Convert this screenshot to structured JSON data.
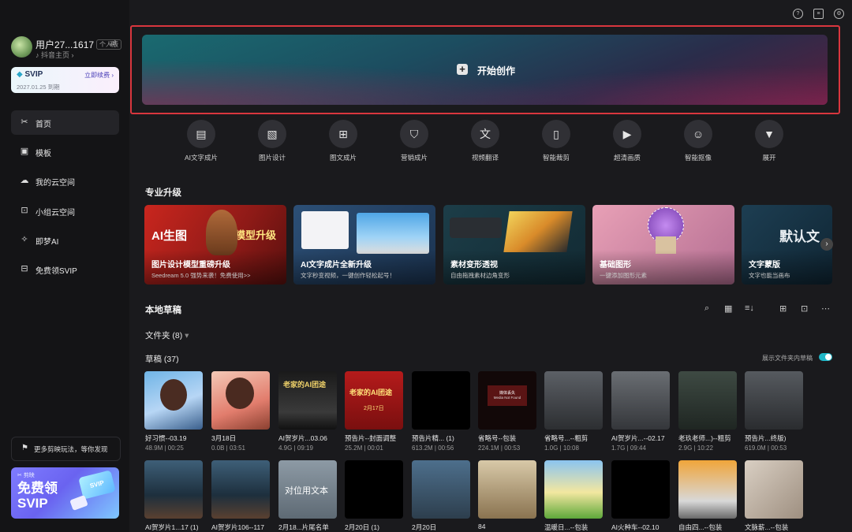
{
  "user": {
    "name": "用户27...1617",
    "badge": "个人版",
    "sub": "抖音主页"
  },
  "svip": {
    "title": "SVIP",
    "expiry": "2027.01.25 到期",
    "renew": "立即续费"
  },
  "nav": [
    {
      "label": "首页",
      "icon": "scissors-icon",
      "active": true
    },
    {
      "label": "模板",
      "icon": "template-icon"
    },
    {
      "label": "我的云空间",
      "icon": "cloud-icon"
    },
    {
      "label": "小组云空间",
      "icon": "group-cloud-icon"
    },
    {
      "label": "即梦AI",
      "icon": "jimeng-icon"
    },
    {
      "label": "免费领SVIP",
      "icon": "gift-icon"
    }
  ],
  "promo": {
    "label": "更多剪映玩法，等你发现"
  },
  "svip_banner": {
    "brand": "剪映",
    "line1": "免费领",
    "line2": "SVIP",
    "card": "SVIP"
  },
  "create": {
    "label": "开始创作"
  },
  "tools": [
    {
      "label": "AI文字成片",
      "icon": "ai-text-video-icon"
    },
    {
      "label": "图片设计",
      "icon": "image-design-icon"
    },
    {
      "label": "图文成片",
      "icon": "text-image-video-icon"
    },
    {
      "label": "营销成片",
      "icon": "marketing-video-icon"
    },
    {
      "label": "视频翻译",
      "icon": "translate-icon"
    },
    {
      "label": "智能裁剪",
      "icon": "smart-crop-icon"
    },
    {
      "label": "超清画质",
      "icon": "hd-quality-icon"
    },
    {
      "label": "智能抠像",
      "icon": "smart-cutout-icon"
    },
    {
      "label": "展开",
      "icon": "expand-icon"
    }
  ],
  "pro_title": "专业升级",
  "pro_cards": [
    {
      "title": "图片设计模型重磅升级",
      "sub": "Seedream 5.0 强势来袭！免费使用>>",
      "art_left": "AI生图",
      "art_right": "模型升级"
    },
    {
      "title": "AI文字成片全新升级",
      "sub": "文字秒变视频，一键创作轻松起号！"
    },
    {
      "title": "素材变形透视",
      "sub": "自由拖拽素材边角变形"
    },
    {
      "title": "基础图形",
      "sub": "一键添加图形元素"
    },
    {
      "title": "文字蒙版",
      "sub": "文字也能当画布",
      "art": "默认文"
    }
  ],
  "local_title": "本地草稿",
  "folders": "文件夹 (8)",
  "drafts_title": "草稿 (37)",
  "toggle_label": "展示文件夹内草稿",
  "drafts_row1": [
    {
      "name": "好习惯--03.19",
      "meta": "48.9M | 00:25"
    },
    {
      "name": "3月18日",
      "meta": "0.0B | 03:51"
    },
    {
      "name": "AI贺岁片...03.06",
      "meta": "4.9G | 09:19"
    },
    {
      "name": "预告片--封面调整",
      "meta": "25.2M | 00:01"
    },
    {
      "name": "预告片精... (1)",
      "meta": "613.2M | 00:56"
    },
    {
      "name": "省略号--包装",
      "meta": "224.1M | 00:53"
    },
    {
      "name": "省略号...--粗剪",
      "meta": "1.0G | 10:08"
    },
    {
      "name": "AI贺岁片...--02.17",
      "meta": "1.7G | 09:44"
    },
    {
      "name": "老玖老师...)--粗剪",
      "meta": "2.9G | 10:22"
    },
    {
      "name": "预告片...终版)",
      "meta": "619.0M | 00:53"
    }
  ],
  "drafts_row2": [
    {
      "name": "AI贺岁片1...17 (1)"
    },
    {
      "name": "AI贺岁片106--117"
    },
    {
      "name": "2月18...片尾名单",
      "thumb_text": "对位用文本"
    },
    {
      "name": "2月20日 (1)"
    },
    {
      "name": "2月20日"
    },
    {
      "name": "84"
    },
    {
      "name": "温暖日...--包装"
    },
    {
      "name": "AI火种车--02.10"
    },
    {
      "name": "自由四...--包装"
    },
    {
      "name": "文脉薪...--包装"
    }
  ],
  "thumb_texts": {
    "t3": "老家的AI团途",
    "t4": "老家的AI团途",
    "t4b": "2月17日",
    "t6": "Media Not Found",
    "t6b": "媒体丢失"
  },
  "colors": {
    "accent": "#20b7c7",
    "highlight": "#d9363e"
  }
}
